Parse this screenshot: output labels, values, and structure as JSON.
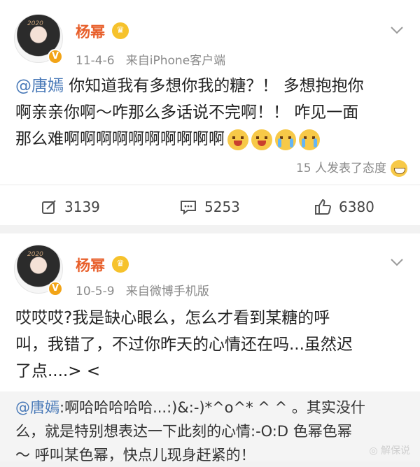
{
  "posts": [
    {
      "username": "杨幂",
      "avatar_tag": "2020",
      "timestamp": "11-4-6",
      "source": "来自iPhone客户端",
      "mention": "@唐嫣",
      "text_line1": " 你知道我有多想你我的糖？！ 多想抱抱你",
      "text_line2": "啊亲亲你啊～咋那么多话说不完啊！！ 咋见一面",
      "text_line3": "那么难啊啊啊啊啊啊啊啊啊啊",
      "emojis": [
        "laugh-cry-emoji",
        "laugh-cry-emoji",
        "crying-emoji",
        "crying-emoji"
      ],
      "reactions_text": "15 人发表了态度",
      "repost_count": "3139",
      "comment_count": "5253",
      "like_count": "6380"
    },
    {
      "username": "杨幂",
      "avatar_tag": "2020",
      "timestamp": "10-5-9",
      "source": "来自微博手机版",
      "text_line1": "哎哎哎?我是缺心眼么，怎么才看到某糖的呼",
      "text_line2": "叫，我错了，不过你昨天的心情还在吗...虽然迟",
      "text_line3": "了点....> <",
      "repost_mention": "@唐嫣",
      "repost_line1": ":啊哈哈哈哈哈...:)&:-)*^o^* ^  ^ 。其实没什",
      "repost_line2": "么，就是特别想表达一下此刻的心情:-O:D 色幂色幂",
      "repost_line3": "～ 呼叫某色幂，快点儿现身赶紧的！"
    }
  ],
  "watermark": "解保说",
  "colors": {
    "username": "#e8602c",
    "mention": "#4a7ab8",
    "badge": "#f2a417",
    "muted": "#8a8a8a"
  }
}
